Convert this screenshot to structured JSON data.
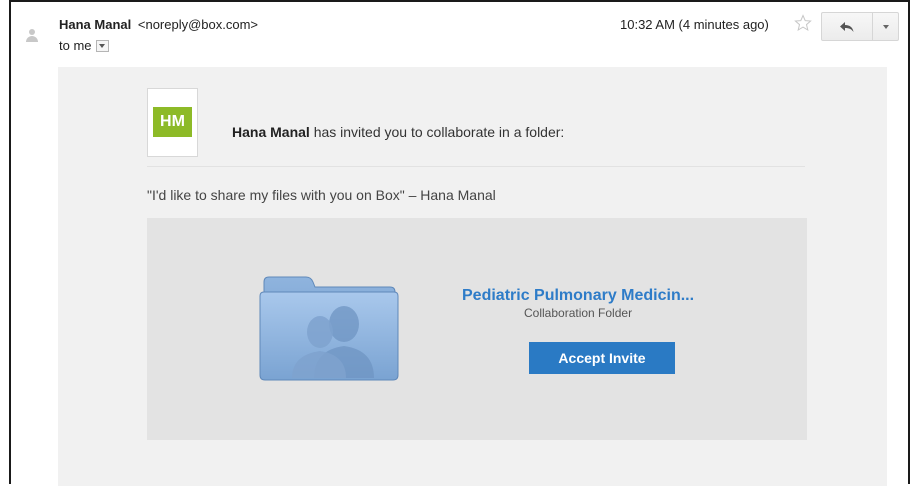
{
  "header": {
    "sender_name": "Hana Manal",
    "sender_email": "<noreply@box.com>",
    "recipient": "to me",
    "timestamp": "10:32 AM (4 minutes ago)"
  },
  "body": {
    "badge_initials": "HM",
    "inviter_name": "Hana Manal",
    "invite_text": " has invited you to collaborate in a folder:",
    "quote": "\"I'd like to share my files with you on Box\" – Hana Manal",
    "folder_name": "Pediatric Pulmonary Medicin...",
    "folder_type": "Collaboration Folder",
    "accept_label": "Accept Invite"
  },
  "colors": {
    "badge": "#8dba27",
    "link": "#2e7cc8",
    "button": "#2a7ac4",
    "body_bg": "#f1f1f1",
    "card_bg": "#e3e3e3"
  },
  "icons": [
    "avatar-icon",
    "star-icon",
    "reply-icon",
    "more-options-icon",
    "shared-folder-icon"
  ]
}
